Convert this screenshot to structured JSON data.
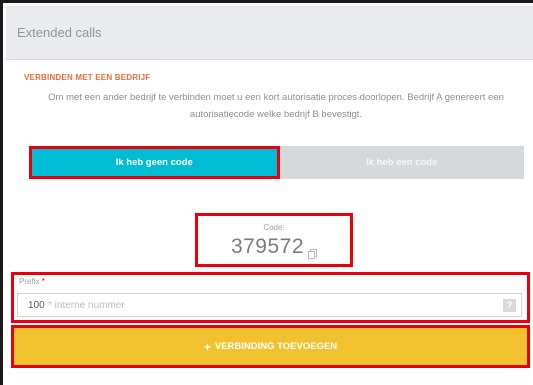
{
  "header": {
    "title": "Extended calls"
  },
  "section": {
    "heading": "VERBINDEN MET EEN BEDRIJF",
    "description": "Om met een ander bedrijf te verbinden moet u een kort autorisatie proces doorlopen. Bedrijf A genereert een autorisatiecode welke bedrijf B bevestigt."
  },
  "tabs": [
    {
      "label": "Ik heb geen code",
      "active": true
    },
    {
      "label": "Ik heb een code",
      "active": false
    }
  ],
  "code": {
    "label": "Code:",
    "value": "379572",
    "icon": "copy-icon"
  },
  "prefix": {
    "label": "Prefix",
    "required_mark": "*",
    "value": "100",
    "placeholder": "* interne nummer",
    "help": "?"
  },
  "add_button": {
    "icon": "plus-icon",
    "plus": "+",
    "label": "VERBINDING TOEVOEGEN"
  },
  "colors": {
    "accent_cyan": "#00bcd4",
    "accent_yellow": "#f2c12e",
    "heading_orange": "#f26b38",
    "highlight_red": "#e8000d"
  }
}
